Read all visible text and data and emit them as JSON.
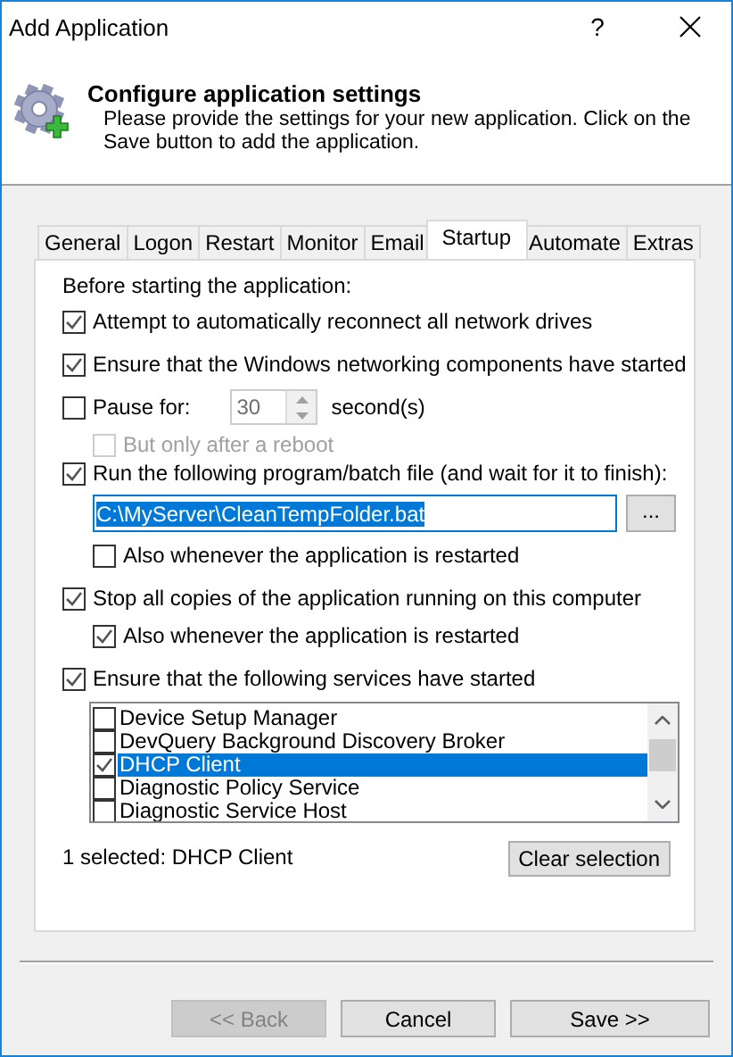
{
  "window": {
    "title": "Add Application",
    "help_label": "?"
  },
  "header": {
    "title": "Configure application settings",
    "description": "Please provide the settings for your new application. Click on the Save button to add the application."
  },
  "tabs": [
    {
      "label": "General",
      "selected": false
    },
    {
      "label": "Logon",
      "selected": false
    },
    {
      "label": "Restart",
      "selected": false
    },
    {
      "label": "Monitor",
      "selected": false
    },
    {
      "label": "Email",
      "selected": false
    },
    {
      "label": "Startup",
      "selected": true
    },
    {
      "label": "Automate",
      "selected": false
    },
    {
      "label": "Extras",
      "selected": false
    }
  ],
  "startup": {
    "intro": "Before starting the application:",
    "options": [
      {
        "kind": "checkbox",
        "label": "Attempt to automatically reconnect all network drives",
        "checked": true
      },
      {
        "kind": "checkbox",
        "label": "Ensure that the Windows networking components have started",
        "checked": true
      },
      {
        "kind": "pause",
        "label": "Pause for:",
        "checked": false,
        "value": "30",
        "unit": "second(s)",
        "children": [
          {
            "kind": "checkbox",
            "label": "But only after a reboot",
            "checked": false,
            "disabled": true
          }
        ]
      },
      {
        "kind": "file",
        "label": "Run the following program/batch file (and wait for it to finish):",
        "checked": true,
        "value": "C:\\MyServer\\CleanTempFolder.bat",
        "browse_label": "...",
        "children": [
          {
            "kind": "checkbox",
            "label": "Also whenever the application is restarted",
            "checked": false
          }
        ]
      },
      {
        "kind": "checkbox",
        "label": "Stop all copies of the application running on this computer",
        "checked": true,
        "children": [
          {
            "kind": "checkbox",
            "label": "Also whenever the application is restarted",
            "checked": true
          }
        ]
      },
      {
        "kind": "services",
        "label": "Ensure that the following services have started",
        "checked": true,
        "services": [
          {
            "name": "Device Setup Manager",
            "checked": false,
            "selected": false
          },
          {
            "name": "DevQuery Background Discovery Broker",
            "checked": false,
            "selected": false
          },
          {
            "name": "DHCP Client",
            "checked": true,
            "selected": true
          },
          {
            "name": "Diagnostic Policy Service",
            "checked": false,
            "selected": false
          },
          {
            "name": "Diagnostic Service Host",
            "checked": false,
            "selected": false
          }
        ],
        "summary": "1 selected: DHCP Client",
        "clear_label": "Clear selection"
      }
    ]
  },
  "buttons": [
    {
      "label": "<< Back",
      "disabled": true
    },
    {
      "label": "Cancel",
      "disabled": false
    },
    {
      "label": "Save >>",
      "disabled": false
    }
  ]
}
